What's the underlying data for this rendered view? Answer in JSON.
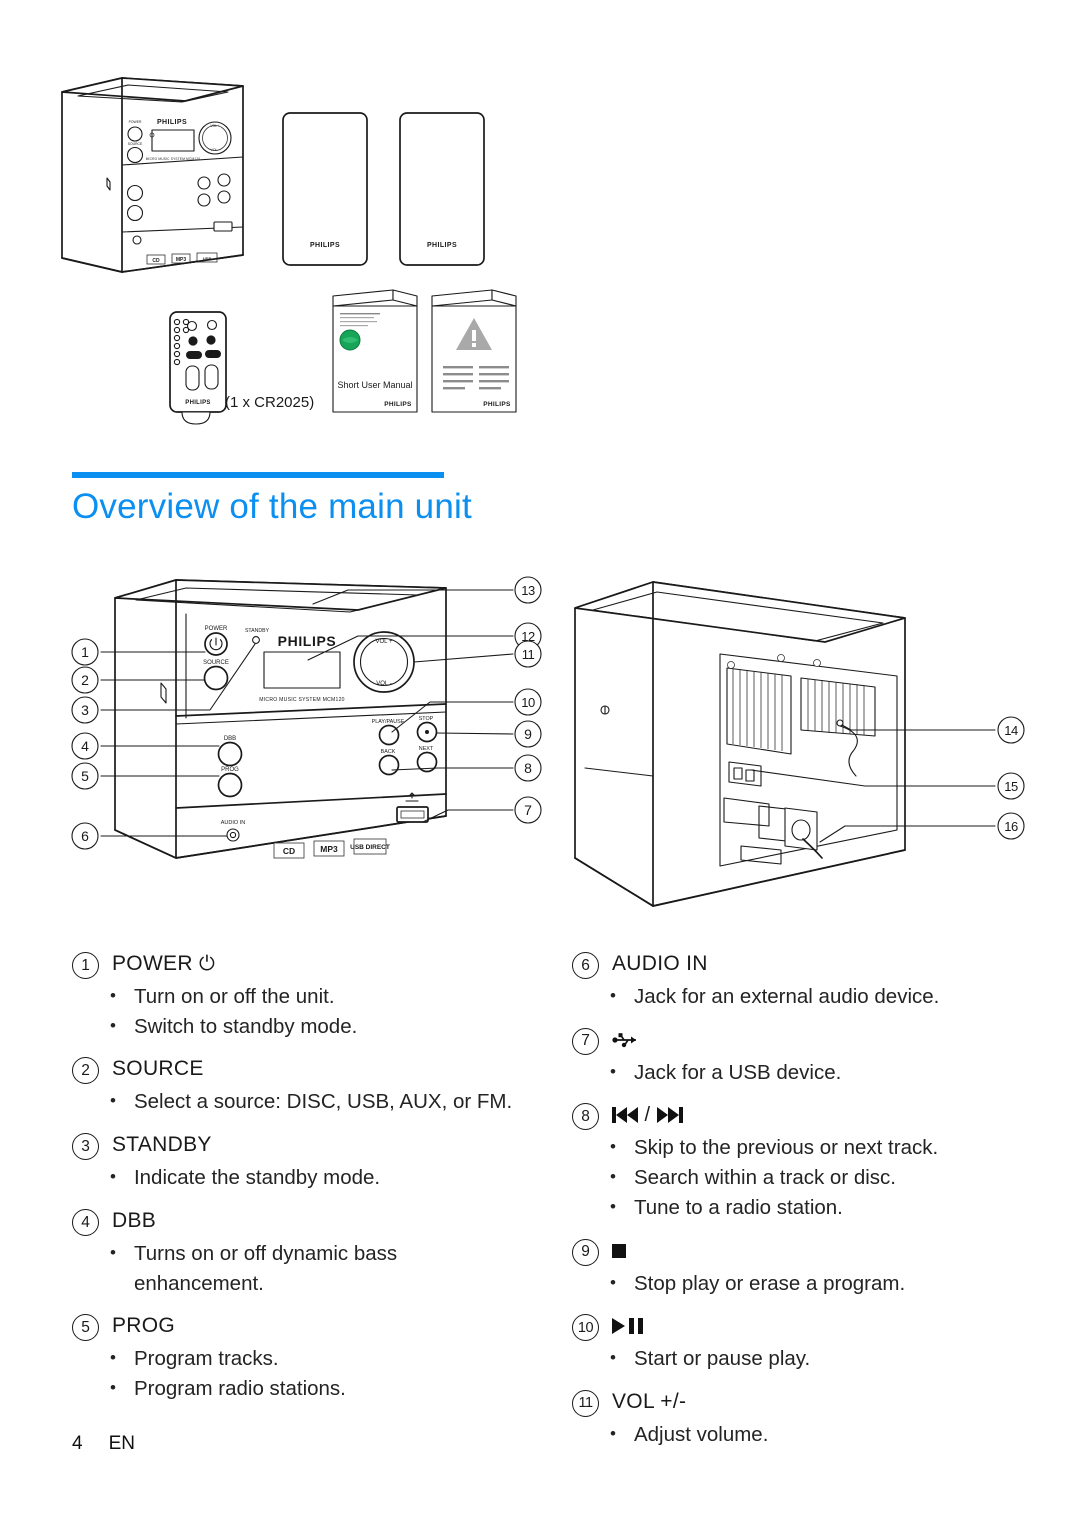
{
  "page": {
    "footer_page_number": "4",
    "footer_language": "EN",
    "accent_color": "#0b8ff0"
  },
  "heading": {
    "title": "Overview of the main unit"
  },
  "hero": {
    "brand": "PHILIPS",
    "unit_display_model": "MICRO MUSIC SYSTEM MCM120",
    "remote_battery_note": "(1 x CR2025)",
    "manual_title": "Short User Manual",
    "speaker_brand_left": "PHILIPS",
    "speaker_brand_right": "PHILIPS",
    "remote_brand": "PHILIPS",
    "manual_brand": "PHILIPS",
    "leaflet_brand": "PHILIPS",
    "disc_logo": "CD",
    "mp3_logo": "MP3",
    "usb_logo": "USB DIRECT"
  },
  "diagram_front": {
    "brand": "PHILIPS",
    "model_line": "MICRO MUSIC SYSTEM MCM120",
    "labels": {
      "power": "POWER",
      "standby": "STANDBY",
      "source": "SOURCE",
      "dbb": "DBB",
      "prog": "PROG",
      "audio_in": "AUDIO IN",
      "play_pause": "PLAY/PAUSE",
      "stop": "STOP",
      "back": "BACK",
      "next": "NEXT",
      "vol_up": "VOL +",
      "vol_down": "VOL -"
    },
    "callouts": [
      "1",
      "2",
      "3",
      "4",
      "5",
      "6",
      "7",
      "8",
      "9",
      "10",
      "11",
      "12",
      "13"
    ]
  },
  "diagram_rear": {
    "callouts": [
      "14",
      "15",
      "16"
    ]
  },
  "legend_left": [
    {
      "number": "1",
      "title": "POWER",
      "icon": "power-standby-icon",
      "bullets": [
        "Turn on or off the unit.",
        "Switch to standby mode."
      ]
    },
    {
      "number": "2",
      "title": "SOURCE",
      "icon": null,
      "bullets": [
        "Select a source: DISC, USB, AUX, or FM."
      ]
    },
    {
      "number": "3",
      "title": "STANDBY",
      "icon": null,
      "bullets": [
        "Indicate the standby mode."
      ]
    },
    {
      "number": "4",
      "title": "DBB",
      "icon": null,
      "bullets": [
        "Turns on or off dynamic bass enhancement."
      ]
    },
    {
      "number": "5",
      "title": "PROG",
      "icon": null,
      "bullets": [
        "Program tracks.",
        "Program radio stations."
      ]
    }
  ],
  "legend_right": [
    {
      "number": "6",
      "title": "AUDIO IN",
      "icon": null,
      "bullets": [
        "Jack for an external audio device."
      ]
    },
    {
      "number": "7",
      "title": "",
      "icon": "usb-icon",
      "bullets": [
        "Jack for a USB device."
      ]
    },
    {
      "number": "8",
      "title": "",
      "icon": "skip-previous-next-icon",
      "bullets": [
        "Skip to the previous or next track.",
        "Search within a track or disc.",
        "Tune to a radio station."
      ]
    },
    {
      "number": "9",
      "title": "",
      "icon": "stop-icon",
      "bullets": [
        "Stop play or erase a program."
      ]
    },
    {
      "number": "10",
      "title": "",
      "icon": "play-pause-icon",
      "bullets": [
        "Start or pause play."
      ]
    },
    {
      "number": "11",
      "title": "VOL +/-",
      "icon": null,
      "bullets": [
        "Adjust volume."
      ]
    }
  ]
}
